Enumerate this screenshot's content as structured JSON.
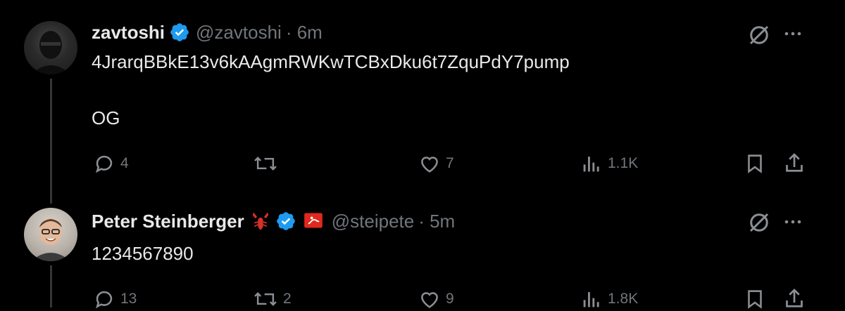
{
  "tweets": [
    {
      "name": "zavtoshi",
      "handle": "@zavtoshi",
      "time": "· 6m",
      "lines": [
        "4JrarqBBkE13v6kAAgmRWKwTCBxDku6t7ZquPdY7pump",
        "OG"
      ],
      "replies": "4",
      "retweets": "",
      "likes": "7",
      "views": "1.1K"
    },
    {
      "name": "Peter Steinberger",
      "handle": "@steipete",
      "time": "· 5m",
      "lines": [
        "1234567890"
      ],
      "replies": "13",
      "retweets": "2",
      "likes": "9",
      "views": "1.8K"
    }
  ],
  "icons": {
    "verified": "verified-badge-icon",
    "emoji": "lobster-emoji-icon",
    "flag": "red-flag-badge-icon",
    "grok": "grok-icon",
    "more": "more-icon",
    "reply": "reply-icon",
    "retweet": "retweet-icon",
    "like": "heart-icon",
    "views": "views-icon",
    "bookmark": "bookmark-icon",
    "share": "share-icon"
  },
  "colors": {
    "background": "#000000",
    "text": "#e7e9ea",
    "muted": "#71767b",
    "verified": "#1d9bf0",
    "thread_line": "#333639"
  }
}
